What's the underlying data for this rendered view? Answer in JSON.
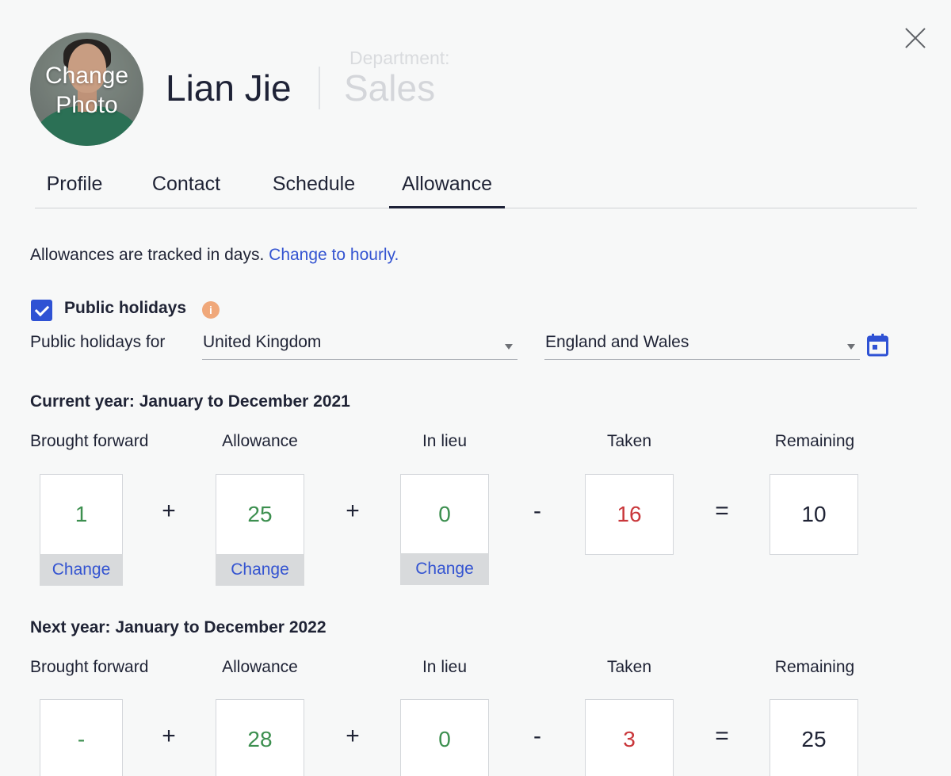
{
  "header": {
    "change_photo": "Change\nPhoto",
    "name": "Lian Jie",
    "department_label": "Department:",
    "department_value": "Sales"
  },
  "tabs": [
    {
      "label": "Profile"
    },
    {
      "label": "Contact"
    },
    {
      "label": "Schedule"
    },
    {
      "label": "Allowance",
      "active": true
    }
  ],
  "tracking": {
    "text": "Allowances are tracked in days.",
    "link": "Change to hourly."
  },
  "public_holidays": {
    "checked": true,
    "label": "Public holidays",
    "info_icon": "i",
    "for_label": "Public holidays for",
    "country": "United Kingdom",
    "region": "England and Wales"
  },
  "columns": [
    "Brought forward",
    "Allowance",
    "In lieu",
    "Taken",
    "Remaining"
  ],
  "operators": [
    "+",
    "+",
    "-",
    "="
  ],
  "change_label": "Change",
  "current_year": {
    "title": "Current year: January to December 2021",
    "values": [
      "1",
      "25",
      "0",
      "16",
      "10"
    ]
  },
  "next_year": {
    "title": "Next year: January to December 2022",
    "values": [
      "-",
      "28",
      "0",
      "3",
      "25"
    ]
  },
  "colors": {
    "accent": "#3454d1",
    "positive": "#3c8f4f",
    "negative": "#c9373b"
  }
}
